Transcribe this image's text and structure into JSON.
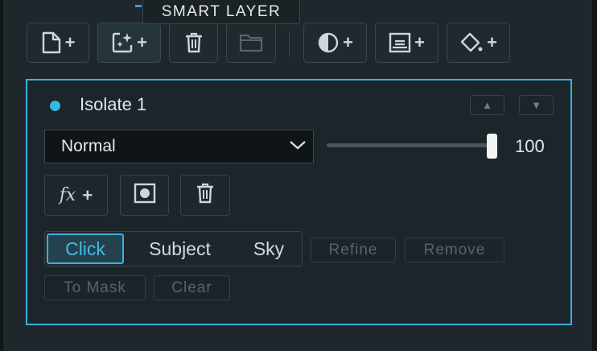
{
  "tooltip": {
    "text": "SMART LAYER"
  },
  "toolbar": {
    "buttons": [
      {
        "name": "new-layer",
        "plus": "+"
      },
      {
        "name": "smart-layer",
        "plus": "+"
      },
      {
        "name": "delete-layer"
      },
      {
        "name": "folder"
      },
      {
        "name": "adjustment-layer",
        "plus": "+"
      },
      {
        "name": "mask-layer",
        "plus": "+"
      },
      {
        "name": "fill-layer",
        "plus": "+"
      }
    ]
  },
  "layer": {
    "name": "Isolate 1",
    "move_up": "▲",
    "move_down": "▼",
    "blend_mode": "Normal",
    "opacity": 100,
    "opacity_label": "100",
    "fx_label": "fx",
    "fx_plus": "+"
  },
  "selection": {
    "segments": [
      "Click",
      "Subject",
      "Sky"
    ],
    "selected": "Click",
    "actions": [
      "Refine",
      "Remove",
      "To Mask",
      "Clear"
    ]
  },
  "colors": {
    "accent": "#3bb0db",
    "background": "#1e272c",
    "panel": "#1b252a",
    "disabled_text": "#56646c"
  }
}
